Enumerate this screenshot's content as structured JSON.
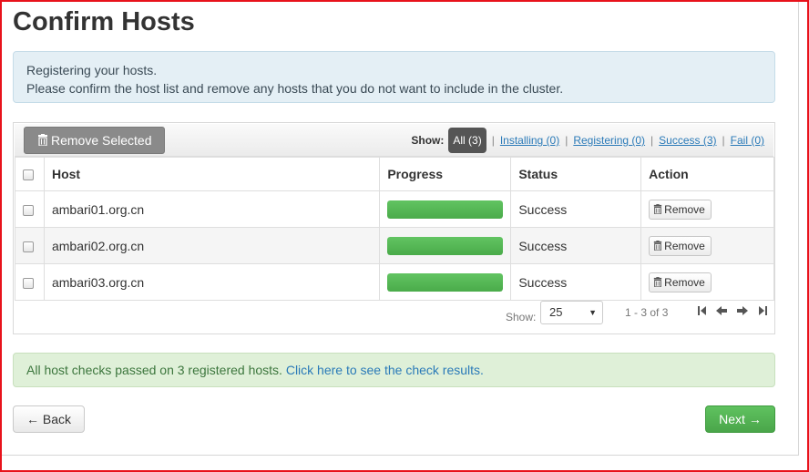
{
  "page": {
    "title": "Confirm Hosts"
  },
  "info_alert": {
    "line1": "Registering your hosts.",
    "line2": "Please confirm the host list and remove any hosts that you do not want to include in the cluster."
  },
  "toolbar": {
    "remove_selected_label": "Remove Selected",
    "show_label": "Show:",
    "filters": {
      "all": "All (3)",
      "installing": "Installing (0)",
      "registering": "Registering (0)",
      "success": "Success (3)",
      "fail": "Fail (0)",
      "separator": "|"
    }
  },
  "table": {
    "headers": {
      "host": "Host",
      "progress": "Progress",
      "status": "Status",
      "action": "Action"
    },
    "rows": [
      {
        "host": "ambari01.org.cn",
        "progress": 1.0,
        "status": "Success",
        "action": "Remove"
      },
      {
        "host": "ambari02.org.cn",
        "progress": 1.0,
        "status": "Success",
        "action": "Remove"
      },
      {
        "host": "ambari03.org.cn",
        "progress": 1.0,
        "status": "Success",
        "action": "Remove"
      }
    ]
  },
  "pager": {
    "show_label": "Show:",
    "page_size": "25",
    "range": "1 - 3 of 3"
  },
  "success_alert": {
    "text": "All host checks passed on 3 registered hosts.",
    "link": "Click here to see the check results."
  },
  "footer": {
    "back_label": "← Back",
    "next_label": "Next →"
  },
  "colors": {
    "progress_bar": "#5cb85c",
    "status_success": "#468847",
    "next_button": "#51b251",
    "link": "#2a7ab8",
    "frame_border": "#e8121b"
  }
}
